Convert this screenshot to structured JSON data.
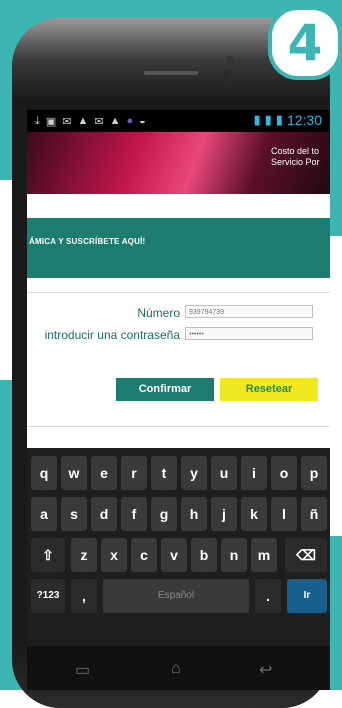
{
  "badge": {
    "number": "4"
  },
  "statusbar": {
    "left_icons": [
      "download-icon",
      "image-icon",
      "mail-icon",
      "warning-icon",
      "mail-icon",
      "warning-icon",
      "app-icon",
      "wifi-icon"
    ],
    "time": "12:30"
  },
  "banner": {
    "line1": "Costo del to",
    "line2": "Servicio Por"
  },
  "promo": {
    "text": "ÁMICA Y SUSCRÍBETE AQUÍ!"
  },
  "form": {
    "numero_label": "Número",
    "numero_value": "939794739",
    "password_label": "introducir una contraseña",
    "password_value": "••••••"
  },
  "buttons": {
    "confirm": "Confirmar",
    "reset": "Resetear"
  },
  "keyboard": {
    "row1": [
      "q",
      "w",
      "e",
      "r",
      "t",
      "y",
      "u",
      "i",
      "o",
      "p"
    ],
    "row2": [
      "a",
      "s",
      "d",
      "f",
      "g",
      "h",
      "j",
      "k",
      "l",
      "ñ"
    ],
    "row3": [
      "z",
      "x",
      "c",
      "v",
      "b",
      "n",
      "m"
    ],
    "shift": "⇧",
    "backspace": "⌫",
    "symbols": "?123",
    "comma": ",",
    "space": "Español",
    "period": ".",
    "go": "Ir"
  },
  "colors": {
    "teal": "#3bb6b3",
    "green": "#1d7c70",
    "yellow": "#f2e81f",
    "status_blue": "#33b5e5"
  }
}
